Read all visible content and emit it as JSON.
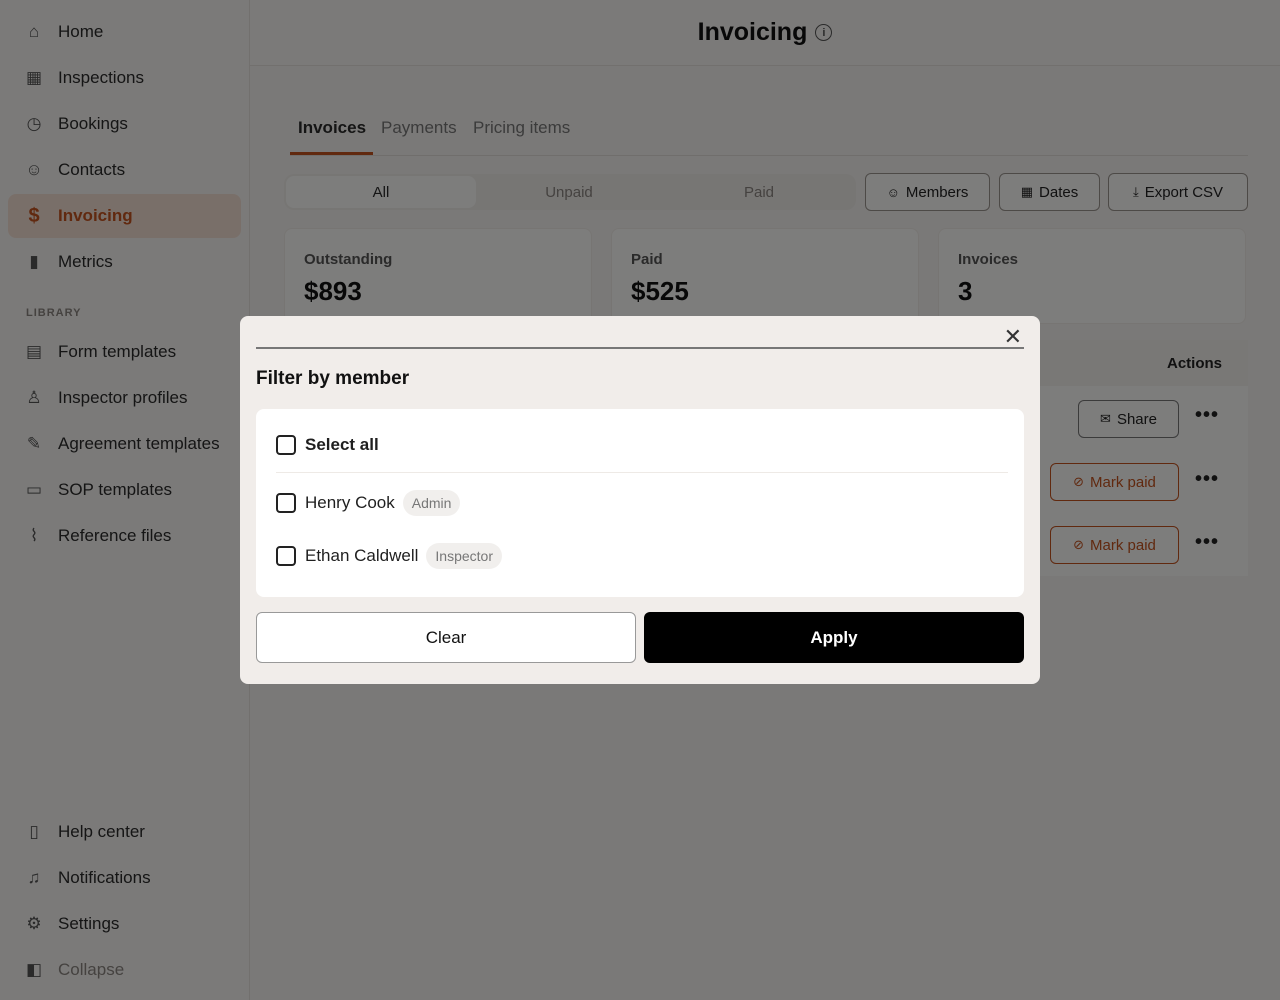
{
  "sidebar": {
    "items": [
      {
        "label": "Home",
        "icon": "home-icon",
        "glyph": "⌂"
      },
      {
        "label": "Inspections",
        "icon": "calendar-icon",
        "glyph": "▦"
      },
      {
        "label": "Bookings",
        "icon": "clock-icon",
        "glyph": "◷"
      },
      {
        "label": "Contacts",
        "icon": "users-icon",
        "glyph": "☺"
      },
      {
        "label": "Invoicing",
        "icon": "dollar-icon",
        "glyph": "$"
      },
      {
        "label": "Metrics",
        "icon": "bar-chart-icon",
        "glyph": "▮"
      }
    ],
    "section_label": "LIBRARY",
    "library_items": [
      {
        "label": "Form templates",
        "icon": "layout-icon",
        "glyph": "▤"
      },
      {
        "label": "Inspector profiles",
        "icon": "user-icon",
        "glyph": "♙"
      },
      {
        "label": "Agreement templates",
        "icon": "signature-icon",
        "glyph": "✎"
      },
      {
        "label": "SOP templates",
        "icon": "document-icon",
        "glyph": "▭"
      },
      {
        "label": "Reference files",
        "icon": "paperclip-icon",
        "glyph": "⌇"
      }
    ],
    "bottom_items": [
      {
        "label": "Help center",
        "icon": "book-icon",
        "glyph": "▯"
      },
      {
        "label": "Notifications",
        "icon": "bell-icon",
        "glyph": "♫"
      },
      {
        "label": "Settings",
        "icon": "gear-icon",
        "glyph": "⚙"
      },
      {
        "label": "Collapse",
        "icon": "sidebar-collapse-icon",
        "glyph": "◧"
      }
    ]
  },
  "header": {
    "title": "Invoicing",
    "info_glyph": "i"
  },
  "tabs": [
    {
      "label": "Invoices"
    },
    {
      "label": "Payments"
    },
    {
      "label": "Pricing items"
    }
  ],
  "filter_segments": [
    {
      "label": "All"
    },
    {
      "label": "Unpaid"
    },
    {
      "label": "Paid"
    }
  ],
  "toolbar": {
    "members_label": "Members",
    "dates_label": "Dates",
    "export_label": "Export CSV"
  },
  "stats": [
    {
      "label": "Outstanding",
      "value": "$893"
    },
    {
      "label": "Paid",
      "value": "$525"
    },
    {
      "label": "Invoices",
      "value": "3"
    }
  ],
  "table": {
    "actions_header": "Actions",
    "rows": [
      {
        "action": "Share"
      },
      {
        "action": "Mark paid"
      },
      {
        "action": "Mark paid"
      }
    ]
  },
  "modal": {
    "title": "Filter by member",
    "close_glyph": "✕",
    "select_all_label": "Select all",
    "members": [
      {
        "name": "Henry Cook",
        "role": "Admin"
      },
      {
        "name": "Ethan Caldwell",
        "role": "Inspector"
      }
    ],
    "clear_label": "Clear",
    "apply_label": "Apply"
  },
  "colors": {
    "accent": "#c2521f",
    "active_bg": "#f3dfd3",
    "apply_bg": "#000000"
  }
}
